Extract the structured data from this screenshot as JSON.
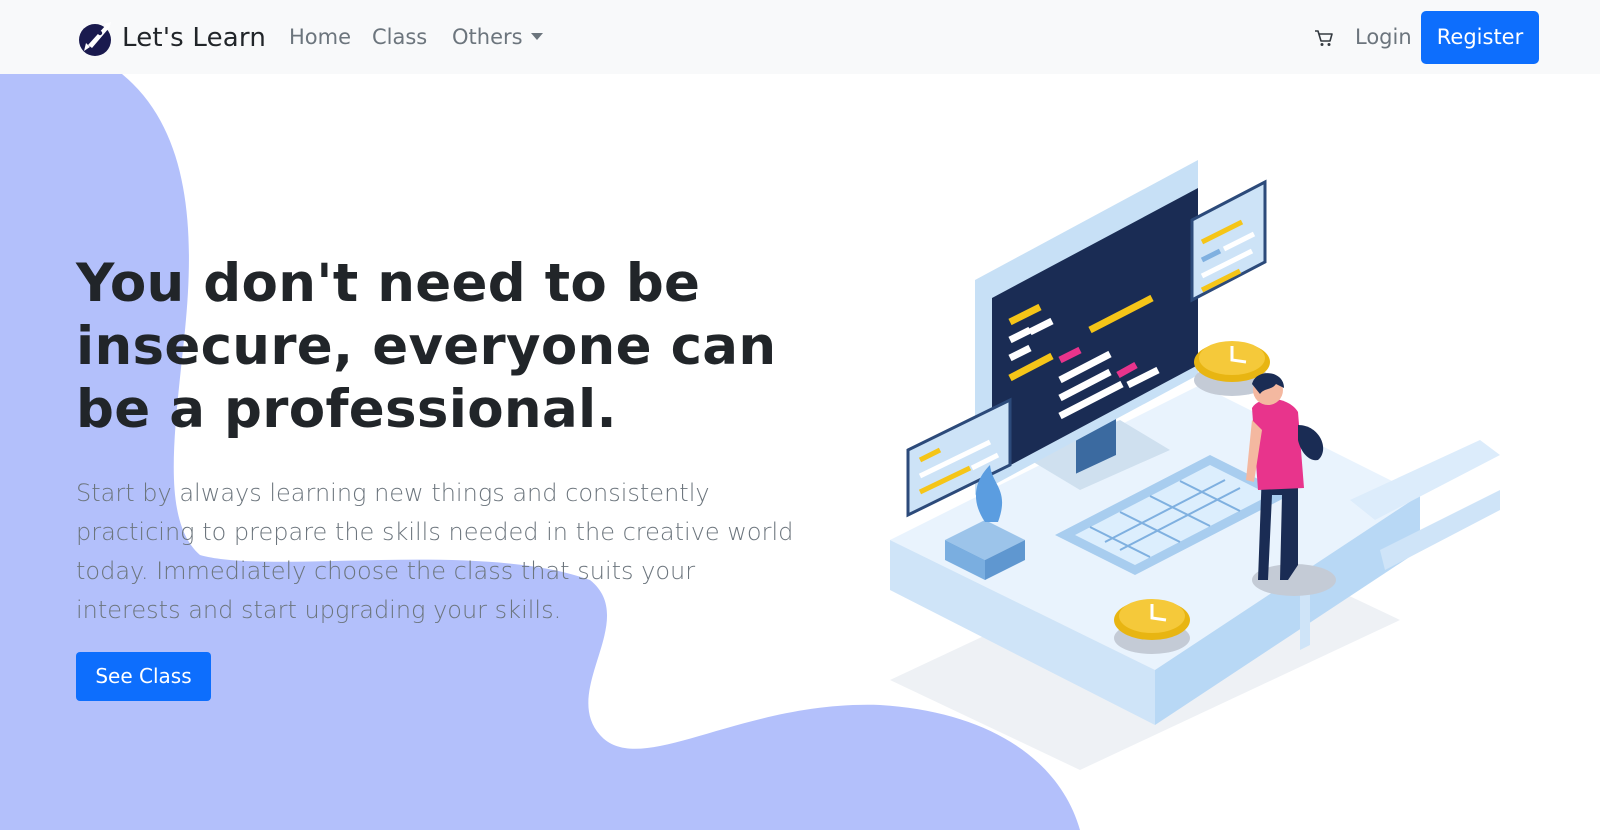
{
  "nav": {
    "brand": "Let's Learn",
    "brand_icon": "rocket-logo-icon",
    "links": [
      "Home",
      "Class",
      "Others"
    ],
    "cart_icon": "cart-icon",
    "login": "Login",
    "register": "Register"
  },
  "hero": {
    "headline": "You don't need to be insecure, everyone can be a professional.",
    "lead": "Start by always learning new things and consistently practicing to prepare the skills needed in the creative world today. Immediately choose the class that suits your interests and start upgrading your skills.",
    "cta": "See Class"
  },
  "colors": {
    "primary": "#0d6efd",
    "blob": "#b3c0fb",
    "navbar_bg": "#f8f9fa",
    "monitor_dark": "#1a2c54",
    "accent_yellow": "#f5c518",
    "accent_pink": "#e8348c"
  }
}
